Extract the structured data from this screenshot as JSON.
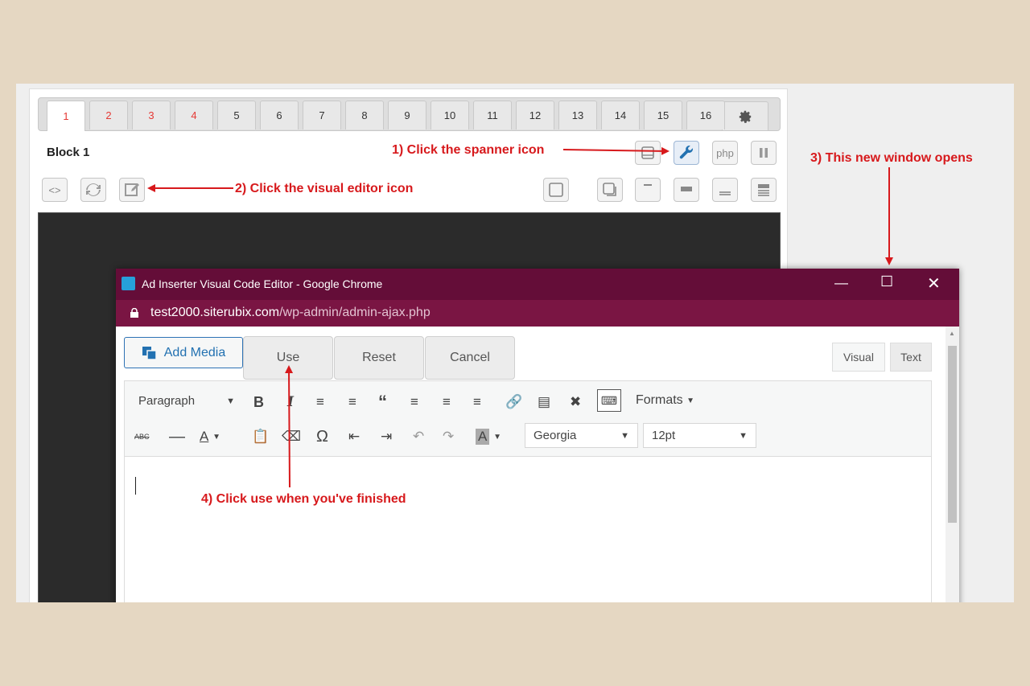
{
  "panel": {
    "tabs": [
      {
        "label": "1",
        "red": true,
        "active": true
      },
      {
        "label": "2",
        "red": true
      },
      {
        "label": "3",
        "red": true
      },
      {
        "label": "4",
        "red": true
      },
      {
        "label": "5"
      },
      {
        "label": "6"
      },
      {
        "label": "7"
      },
      {
        "label": "8"
      },
      {
        "label": "9"
      },
      {
        "label": "10"
      },
      {
        "label": "11"
      },
      {
        "label": "12"
      },
      {
        "label": "13"
      },
      {
        "label": "14"
      },
      {
        "label": "15"
      },
      {
        "label": "16"
      }
    ],
    "block_title": "Block 1",
    "php_label": "php",
    "code_toggle_label": "<>"
  },
  "window": {
    "title": "Ad Inserter Visual Code Editor - Google Chrome",
    "url_host": "test2000.siterubix.com",
    "url_path": "/wp-admin/admin-ajax.php",
    "add_media_label": "Add Media",
    "use_label": "Use",
    "reset_label": "Reset",
    "cancel_label": "Cancel",
    "visual_tab_label": "Visual",
    "text_tab_label": "Text",
    "paragraph_select": "Paragraph",
    "formats_label": "Formats",
    "font_select": "Georgia",
    "size_select": "12pt",
    "toolbar_row1": [
      "bold-icon",
      "italic-icon",
      "bullet-list-icon",
      "numbered-list-icon",
      "blockquote-icon",
      "align-left-icon",
      "align-center-icon",
      "align-right-icon",
      "link-icon",
      "read-more-icon",
      "fullscreen-icon",
      "toolbar-toggle-icon"
    ],
    "toolbar_row2": [
      "strikethrough-icon",
      "horizontal-line-icon",
      "text-color-icon",
      "paste-as-text-icon",
      "clear-formatting-icon",
      "special-character-icon",
      "outdent-icon",
      "indent-icon",
      "undo-icon",
      "redo-icon",
      "background-color-icon"
    ]
  },
  "annotations": {
    "step1": "1) Click the spanner icon",
    "step2": "2) Click the visual editor icon",
    "step3": "3) This new window opens",
    "step4": "4) Click use when you've finished"
  },
  "colors": {
    "annotation": "#d7191c",
    "window_titlebar": "#640d38",
    "window_urlbar": "#7a1543",
    "background": "#e5d7c2"
  }
}
